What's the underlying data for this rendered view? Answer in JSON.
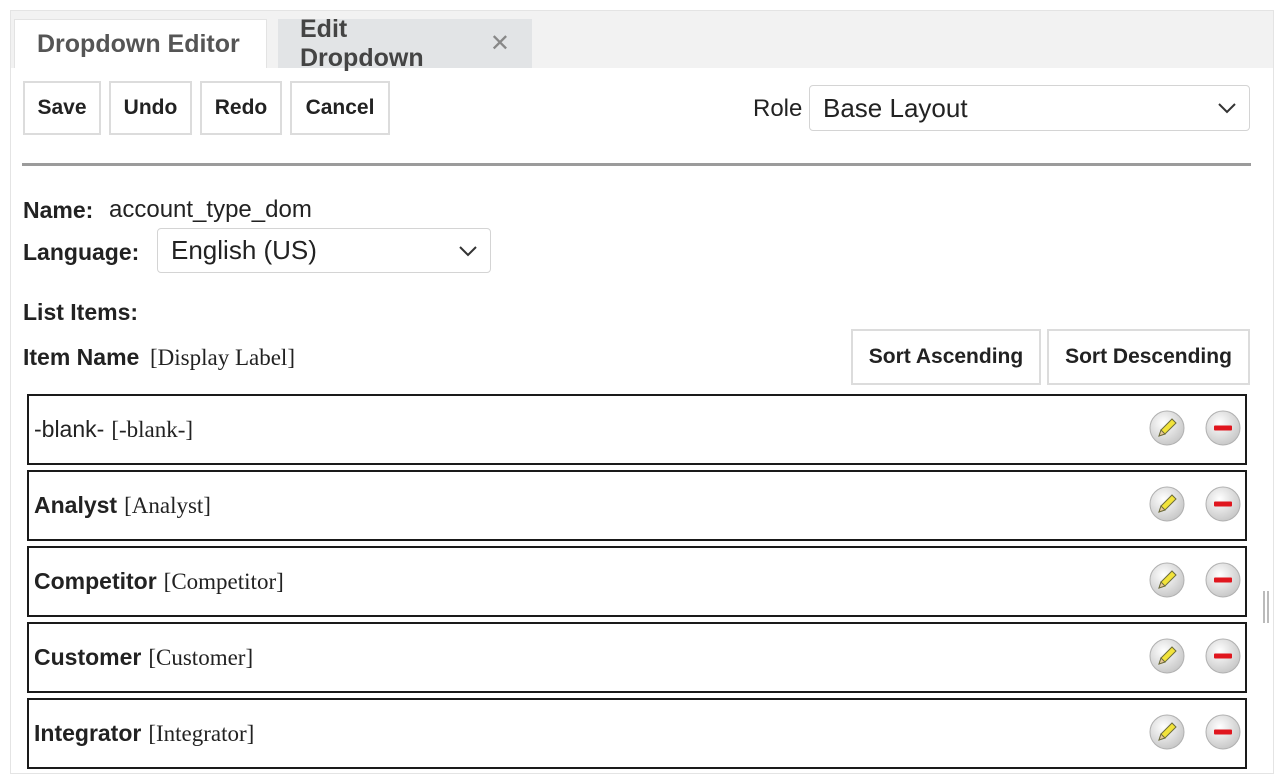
{
  "tabs": [
    {
      "label": "Dropdown Editor"
    },
    {
      "label": "Edit Dropdown",
      "close_icon": "close-icon"
    }
  ],
  "toolbar": {
    "save_label": "Save",
    "undo_label": "Undo",
    "redo_label": "Redo",
    "cancel_label": "Cancel"
  },
  "role": {
    "label": "Role",
    "selected": "Base Layout"
  },
  "form": {
    "name_label": "Name:",
    "name_value": "account_type_dom",
    "language_label": "Language:",
    "language_selected": "English (US)",
    "list_items_label": "List Items:"
  },
  "list_header": {
    "item_name": "Item Name",
    "display_label": "[Display Label]",
    "sort_ascending": "Sort Ascending",
    "sort_descending": "Sort Descending"
  },
  "items": [
    {
      "name": "-blank-",
      "label": "[-blank-]"
    },
    {
      "name": "Analyst",
      "label": "[Analyst]"
    },
    {
      "name": "Competitor",
      "label": "[Competitor]"
    },
    {
      "name": "Customer",
      "label": "[Customer]"
    },
    {
      "name": "Integrator",
      "label": "[Integrator]"
    }
  ],
  "icons": {
    "edit": "pencil-icon",
    "remove": "minus-circle-icon"
  },
  "colors": {
    "remove_red": "#e0161e",
    "edit_yellow": "#f2e33a"
  }
}
